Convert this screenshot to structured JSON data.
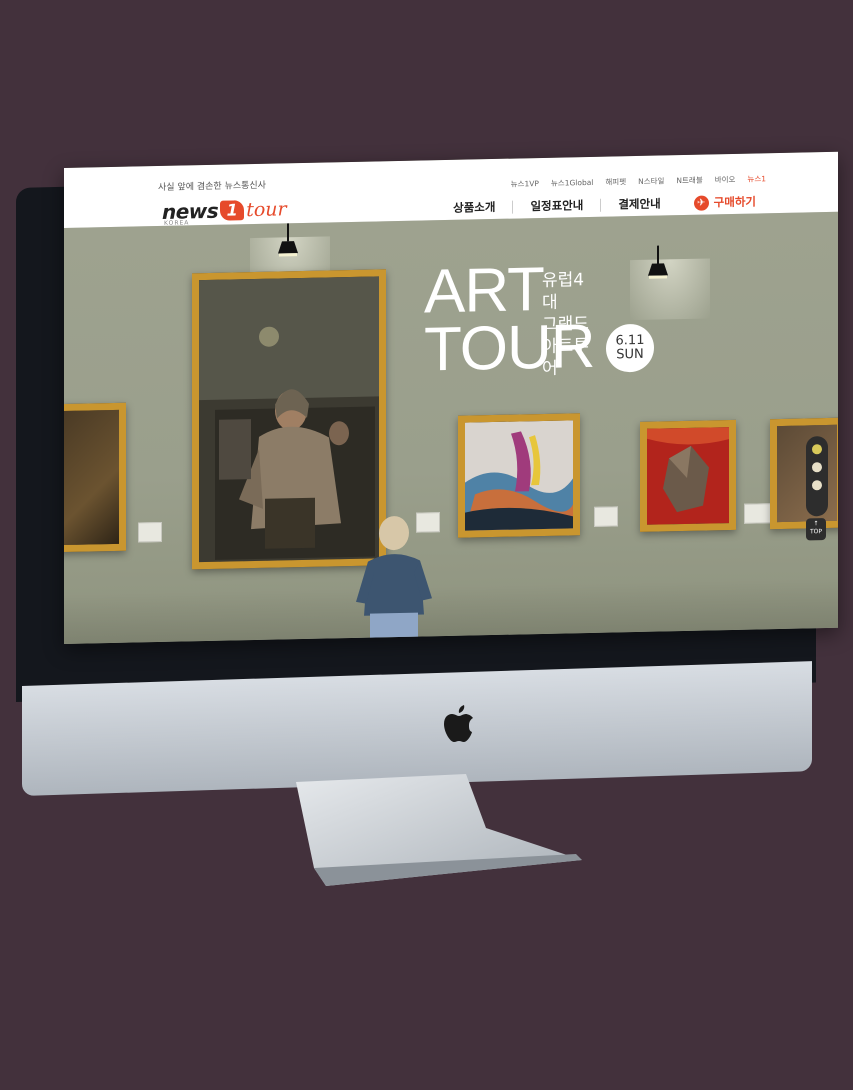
{
  "header": {
    "tagline": "사실 앞에 겸손한 뉴스통신사",
    "logo": {
      "news": "news",
      "one": "1",
      "tour": "tour",
      "sub": "KOREA"
    },
    "util_links": [
      {
        "label": "뉴스1VP"
      },
      {
        "label": "뉴스1Global"
      },
      {
        "label": "해피펫"
      },
      {
        "label": "N스타일"
      },
      {
        "label": "N트래블"
      },
      {
        "label": "바이오"
      },
      {
        "label": "뉴스1",
        "active": true
      }
    ],
    "nav": {
      "products": "상품소개",
      "schedule": "일정표안내",
      "payment": "결제안내",
      "buy": "구매하기"
    }
  },
  "hero": {
    "title_line1": "ART",
    "title_line2": "TOUR",
    "subtitle_line1": "유럽4대",
    "subtitle_line2": "그랜드 아트투어",
    "date": "6.11",
    "day": "SUN"
  },
  "widget": {
    "top_label": "TOP",
    "top_arrow": "↑"
  },
  "colors": {
    "accent": "#e64a2b",
    "gold_frame": "#c9962f",
    "wall": "#9ea28f",
    "background": "#43313c"
  },
  "icons": {
    "buy": "airplane-icon",
    "device_logo": "apple-logo-icon"
  }
}
